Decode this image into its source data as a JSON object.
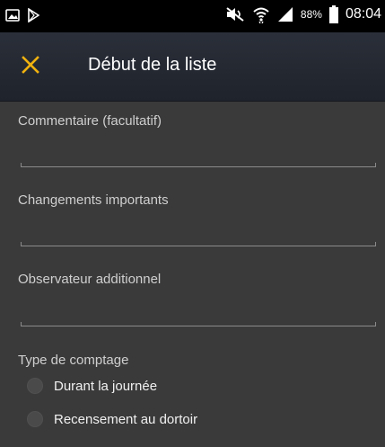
{
  "status_bar": {
    "battery_percent": "88%",
    "time": "08:04",
    "icons": [
      "image-icon",
      "play-store-icon",
      "mute-icon",
      "wifi-icon",
      "signal-icon",
      "battery-icon"
    ]
  },
  "app_bar": {
    "title": "Début de la liste",
    "close_icon": "close-icon",
    "accent_color": "#f0b20f"
  },
  "form": {
    "comment_label": "Commentaire (facultatif)",
    "comment_value": "",
    "changes_label": "Changements importants",
    "changes_value": "",
    "observer_label": "Observateur additionnel",
    "observer_value": "",
    "count_type_label": "Type de comptage",
    "count_options": [
      "Durant la journée",
      "Recensement au dortoir"
    ],
    "count_selected": null
  },
  "colors": {
    "background": "#3a3a3a",
    "app_bar": "#252a33",
    "status_bar": "#000000"
  }
}
